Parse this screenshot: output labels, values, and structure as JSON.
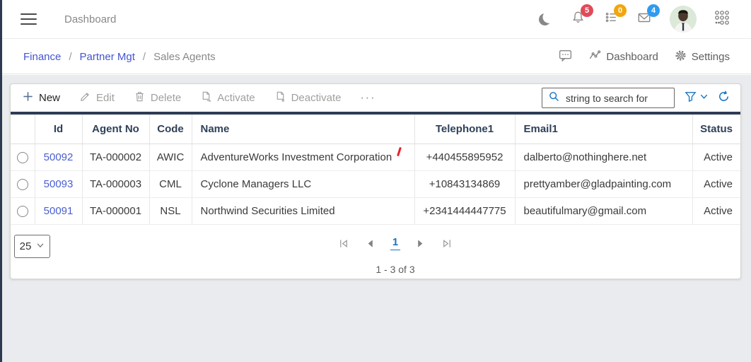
{
  "topbar": {
    "title": "Dashboard",
    "notifications_badge": "5",
    "tasks_badge": "0",
    "messages_badge": "4"
  },
  "breadcrumb": {
    "items": [
      "Finance",
      "Partner Mgt",
      "Sales Agents"
    ],
    "separator": "/",
    "dashboard_label": "Dashboard",
    "settings_label": "Settings"
  },
  "toolbar": {
    "new_label": "New",
    "edit_label": "Edit",
    "delete_label": "Delete",
    "activate_label": "Activate",
    "deactivate_label": "Deactivate",
    "more_glyph": "···",
    "search_placeholder": "string to search for"
  },
  "table": {
    "columns": [
      "Id",
      "Agent No",
      "Code",
      "Name",
      "Telephone1",
      "Email1",
      "Status"
    ],
    "rows": [
      {
        "id": "50092",
        "agent_no": "TA-000002",
        "code": "AWIC",
        "name": "AdventureWorks Investment Corporation",
        "telephone1": "+440455895952",
        "email1": "dalberto@nothinghere.net",
        "status": "Active"
      },
      {
        "id": "50093",
        "agent_no": "TA-000003",
        "code": "CML",
        "name": "Cyclone Managers LLC",
        "telephone1": "+10843134869",
        "email1": "prettyamber@gladpainting.com",
        "status": "Active"
      },
      {
        "id": "50091",
        "agent_no": "TA-000001",
        "code": "NSL",
        "name": "Northwind Securities Limited",
        "telephone1": "+2341444447775",
        "email1": "beautifulmary@gmail.com",
        "status": "Active"
      }
    ]
  },
  "pagination": {
    "page_size": "25",
    "current_page": "1",
    "range_label": "1 - 3 of 3"
  },
  "colors": {
    "accent_blue": "#1673c2",
    "link_blue": "#4355d0",
    "navy": "#2e3c55",
    "badge_red": "#e04b59",
    "badge_orange": "#f2a60d",
    "badge_blue": "#2e9bf0",
    "page_bg": "#e9ebee"
  }
}
